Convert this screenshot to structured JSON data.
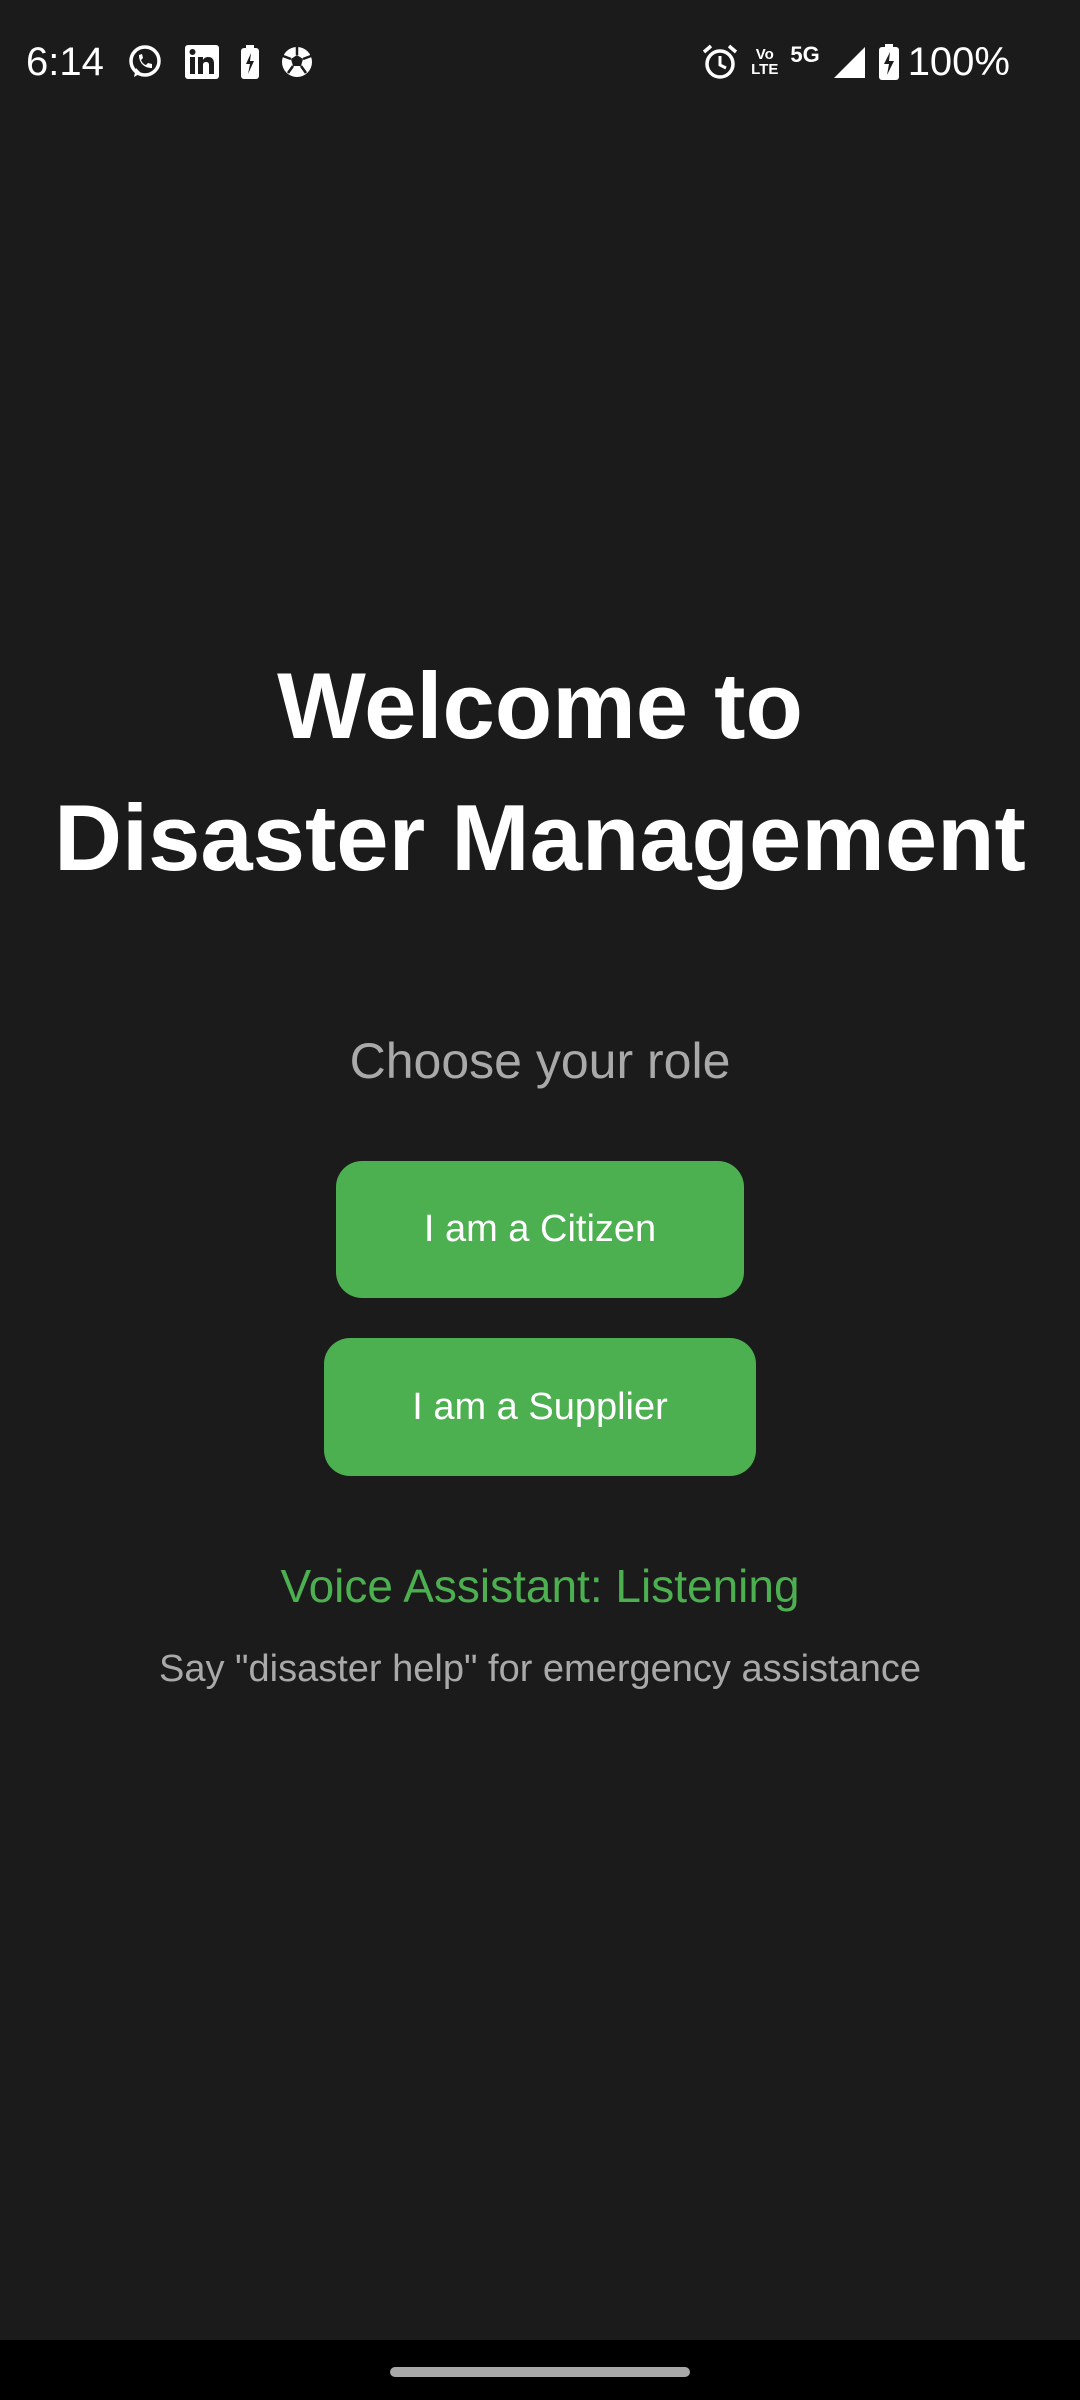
{
  "status_bar": {
    "time": "6:14",
    "left_icons": [
      "whatsapp-icon",
      "linkedin-icon",
      "battery-saver-icon",
      "football-icon"
    ],
    "right_icons": [
      "alarm-icon",
      "volte-icon",
      "5g-icon",
      "signal-icon",
      "battery-icon"
    ],
    "volte_top": "Vo",
    "volte_bottom": "LTE",
    "network": "5G",
    "battery_percent": "100%"
  },
  "welcome": {
    "title_line1": "Welcome to",
    "title_line2": "Disaster Management"
  },
  "role_prompt": "Choose your role",
  "buttons": {
    "citizen_label": "I am a Citizen",
    "supplier_label": "I am a Supplier"
  },
  "voice_assistant": {
    "status": "Voice Assistant: Listening",
    "hint": "Say \"disaster help\" for emergency assistance"
  },
  "colors": {
    "background": "#1b1b1b",
    "accent": "#4caf50",
    "text_primary": "#ffffff",
    "text_secondary": "#a9a9a9",
    "nav_bar": "#000000"
  }
}
